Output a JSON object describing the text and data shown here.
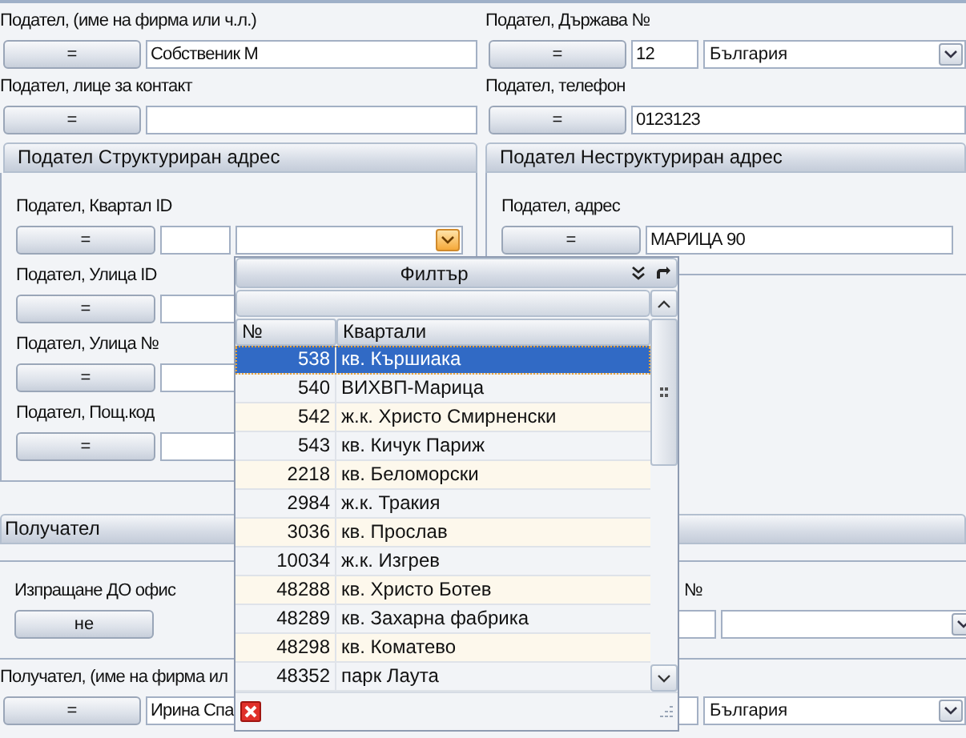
{
  "sender_top": [
    {
      "label": "Подател, (име на фирма или ч.л.)",
      "button": "=",
      "kind": "text",
      "value": "Собственик М"
    },
    {
      "label": "Подател, Държава №",
      "button": "=",
      "kind": "code_select",
      "code": "12",
      "value": "България",
      "active": false
    },
    {
      "label": "Подател, лице за контакт",
      "button": "=",
      "kind": "text"
    },
    {
      "label": "Подател, телефон",
      "button": "=",
      "kind": "text",
      "value": "0123123"
    }
  ],
  "structured_address": {
    "title": "Подател Структуриран адрес",
    "fields": [
      {
        "label": "Подател, Квартал ID",
        "button": "=",
        "kind": "code_select",
        "active": true
      },
      {
        "label": "Подател, Улица ID",
        "button": "=",
        "kind": "code_text"
      },
      {
        "label": "Подател, Улица №",
        "button": "=",
        "kind": "code_text"
      },
      {
        "label": "Подател, Пощ.код",
        "button": "=",
        "kind": "code_text"
      }
    ]
  },
  "unstructured_address": {
    "title": "Подател Неструктуриран адрес",
    "fields": [
      {
        "label": "Подател, адрес",
        "button": "=",
        "kind": "text",
        "value": "МАРИЦА 90"
      }
    ]
  },
  "recipient": {
    "title": "Получател",
    "office_row": [
      {
        "label": "Изпращане ДО офис",
        "button": "не",
        "kind": "button_only"
      },
      {
        "label": "№",
        "kind": "code_select",
        "active": false
      }
    ],
    "fields": [
      {
        "label": "Получател, (име на фирма ил",
        "button": "=",
        "kind": "text",
        "value": "Ирина Спа"
      },
      {
        "kind": "code_select",
        "value": "България",
        "active": false
      }
    ]
  },
  "filter_popup": {
    "title": "Филтър",
    "columns": [
      "№",
      "Квартали"
    ],
    "rows": [
      {
        "number": "538",
        "name": "кв. Кършиака",
        "selected": true
      },
      {
        "number": "540",
        "name": "ВИХВП-Марица",
        "selected": false
      },
      {
        "number": "542",
        "name": "ж.к. Христо Смирненски",
        "selected": false
      },
      {
        "number": "543",
        "name": "кв. Кичук Париж",
        "selected": false
      },
      {
        "number": "2218",
        "name": "кв. Беломорски",
        "selected": false
      },
      {
        "number": "2984",
        "name": "ж.к. Тракия",
        "selected": false
      },
      {
        "number": "3036",
        "name": "кв. Прослав",
        "selected": false
      },
      {
        "number": "10034",
        "name": "ж.к. Изгрев",
        "selected": false
      },
      {
        "number": "48288",
        "name": "кв. Христо Ботев",
        "selected": false
      },
      {
        "number": "48289",
        "name": "кв. Захарна фабрика",
        "selected": false
      },
      {
        "number": "48298",
        "name": "кв. Коматево",
        "selected": false
      },
      {
        "number": "48352",
        "name": "парк Лаута",
        "selected": false
      }
    ]
  }
}
